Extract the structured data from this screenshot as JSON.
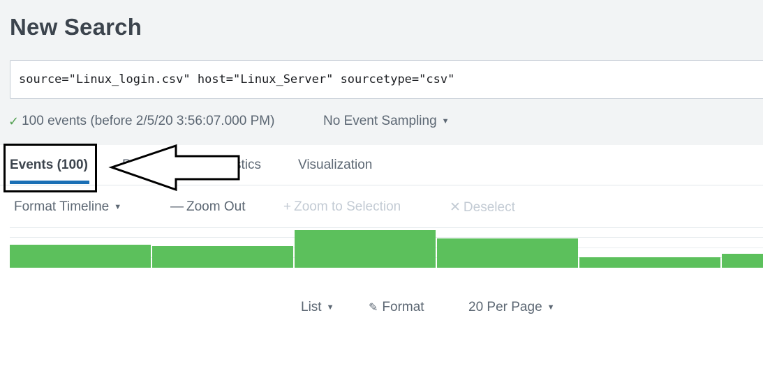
{
  "page": {
    "title": "New Search"
  },
  "search": {
    "query": "source=\"Linux_login.csv\" host=\"Linux_Server\" sourcetype=\"csv\""
  },
  "status": {
    "check": "✓",
    "events_text": "100 events (before 2/5/20 3:56:07.000 PM)",
    "sampling_label": "No Event Sampling"
  },
  "tabs": [
    {
      "label": "Events (100)",
      "active": true
    },
    {
      "label": "Patterns"
    },
    {
      "label": "Statistics"
    },
    {
      "label": "Visualization"
    }
  ],
  "timeline": {
    "format_label": "Format Timeline",
    "zoom_out_label": "Zoom Out",
    "zoom_out_icon": "—",
    "zoom_selection_label": "Zoom to Selection",
    "zoom_selection_icon": "+",
    "deselect_label": "Deselect",
    "deselect_icon": "✕"
  },
  "histogram": {
    "bar_color": "#5cc05c",
    "relative_heights": [
      0.62,
      0.58,
      1.0,
      0.77,
      0.28,
      0.37
    ]
  },
  "results": {
    "list_label": "List",
    "format_label": "Format",
    "per_page_label": "20 Per Page"
  },
  "icons": {
    "check": "check-icon",
    "caret": "caret-down-icon",
    "pencil": "pencil-icon",
    "minus": "minus-icon",
    "plus": "plus-icon",
    "close": "x-icon"
  },
  "colors": {
    "accent": "#1a6fb5",
    "success": "#53a051",
    "bar": "#5cc05c",
    "header_bg": "#f2f4f5"
  }
}
